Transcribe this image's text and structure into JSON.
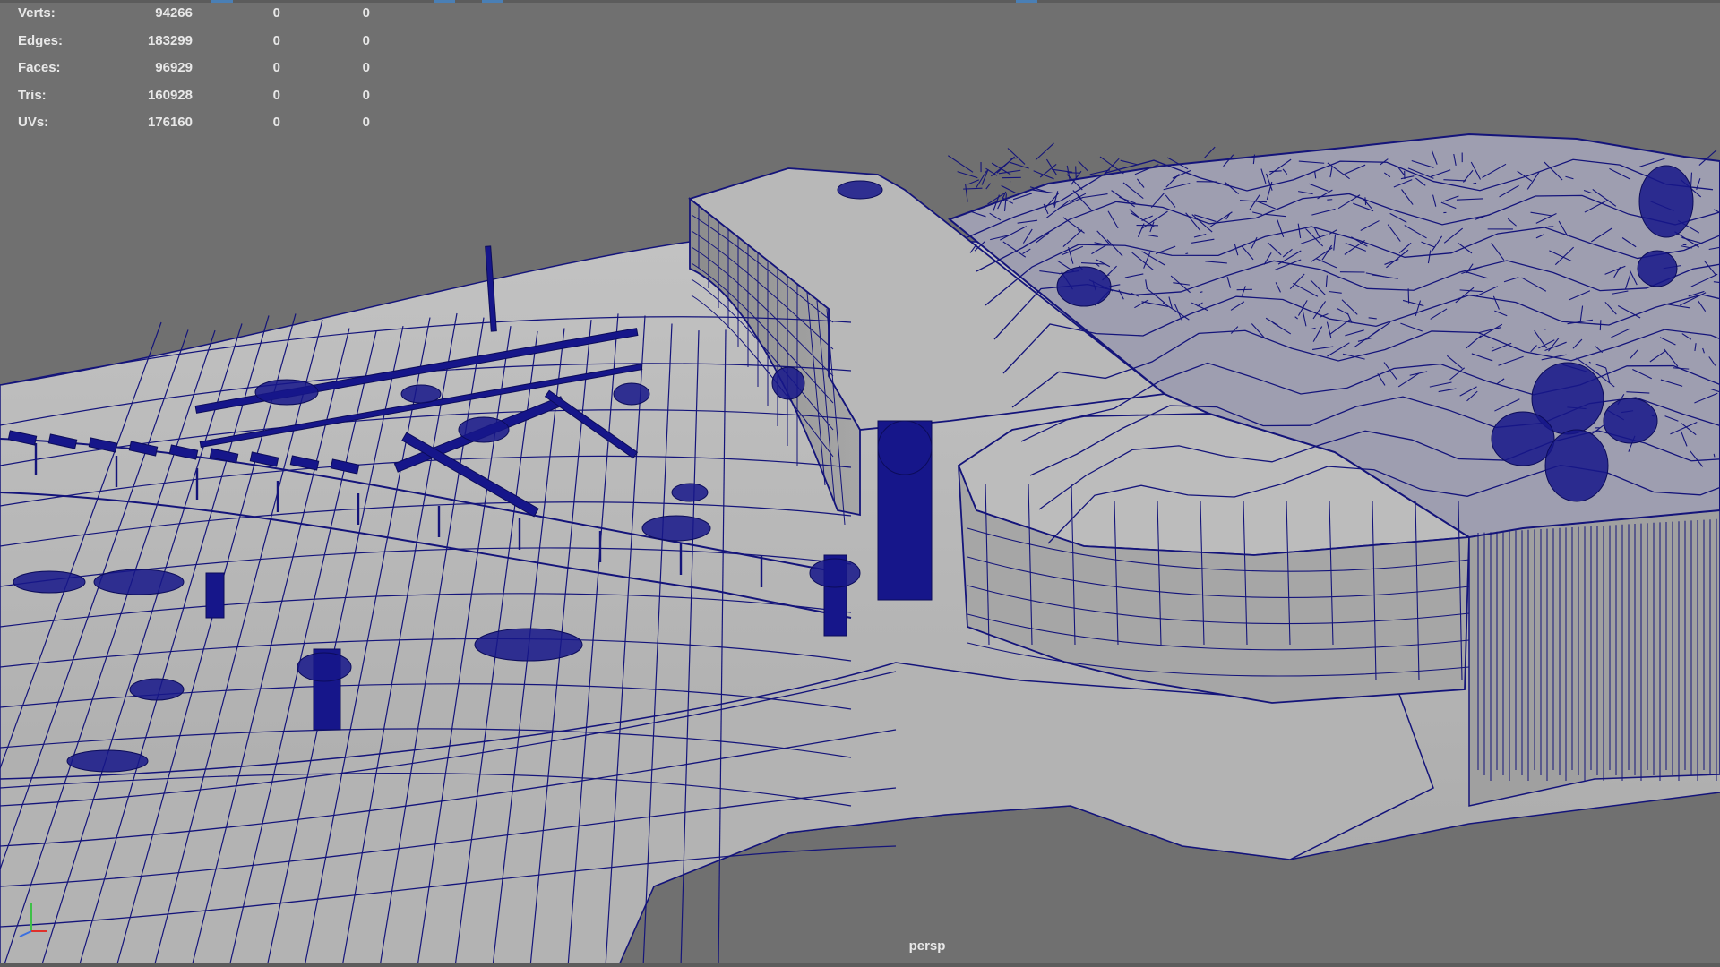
{
  "hud": {
    "rows": [
      {
        "label": "Verts:",
        "total": "94266",
        "selected": "0",
        "selected_2": "0"
      },
      {
        "label": "Edges:",
        "total": "183299",
        "selected": "0",
        "selected_2": "0"
      },
      {
        "label": "Faces:",
        "total": "96929",
        "selected": "0",
        "selected_2": "0"
      },
      {
        "label": "Tris:",
        "total": "160928",
        "selected": "0",
        "selected_2": "0"
      },
      {
        "label": "UVs:",
        "total": "176160",
        "selected": "0",
        "selected_2": "0"
      }
    ]
  },
  "viewport": {
    "camera_name": "persp",
    "background_color": "#707070",
    "surface_color": "#b6b6b6",
    "wireframe_color": "#14147a"
  },
  "axis_gizmo": {
    "x_color": "#e0302a",
    "y_color": "#3ec048",
    "z_color": "#3a6fe0"
  }
}
